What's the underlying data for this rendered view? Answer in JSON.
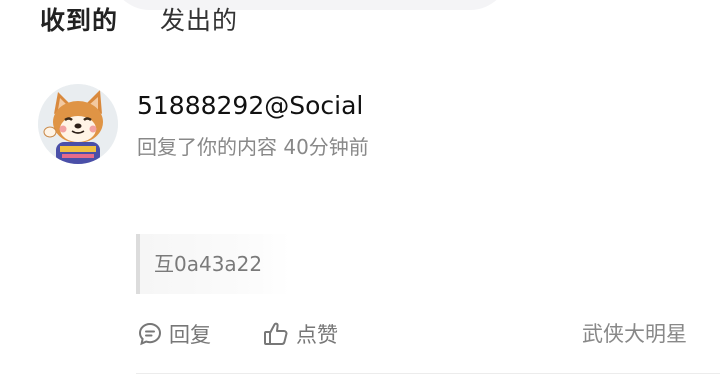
{
  "tabs": [
    {
      "label": "收到的",
      "active": true
    },
    {
      "label": "发出的",
      "active": false
    }
  ],
  "accent_color": "#2fdcc2",
  "notification": {
    "avatar_icon": "shiba-dog-avatar",
    "user": "51888292@Social",
    "meta": "回复了你的内容 40分钟前",
    "quote": "互0a43a22",
    "actions": {
      "reply_label": "回复",
      "like_label": "点赞"
    },
    "source": "武侠大明星"
  }
}
